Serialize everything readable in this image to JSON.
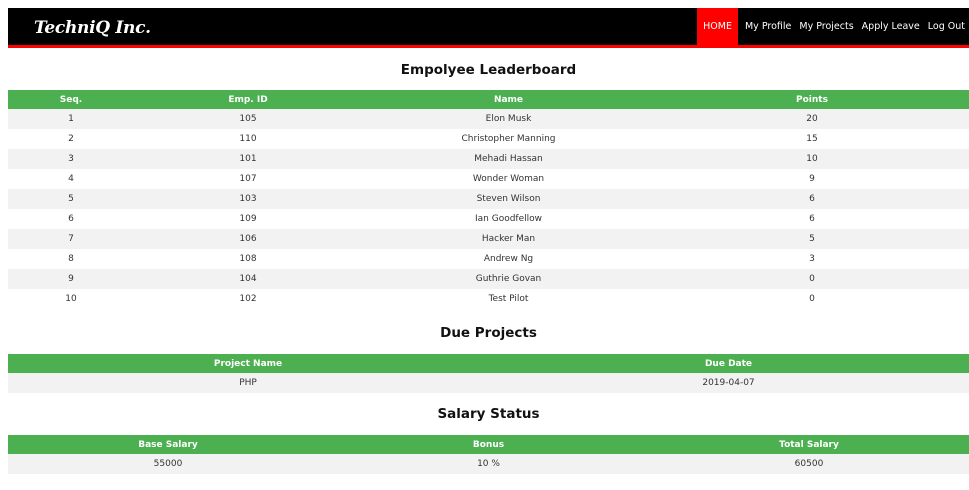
{
  "brand": "TechniQ Inc.",
  "nav": [
    {
      "label": "HOME",
      "active": true
    },
    {
      "label": "My Profile",
      "active": false
    },
    {
      "label": "My Projects",
      "active": false
    },
    {
      "label": "Apply Leave",
      "active": false
    },
    {
      "label": "Log Out",
      "active": false
    }
  ],
  "leaderboard": {
    "title": "Empolyee Leaderboard",
    "columns": [
      "Seq.",
      "Emp. ID",
      "Name",
      "Points"
    ],
    "rows": [
      [
        "1",
        "105",
        "Elon Musk",
        "20"
      ],
      [
        "2",
        "110",
        "Christopher Manning",
        "15"
      ],
      [
        "3",
        "101",
        "Mehadi Hassan",
        "10"
      ],
      [
        "4",
        "107",
        "Wonder Woman",
        "9"
      ],
      [
        "5",
        "103",
        "Steven Wilson",
        "6"
      ],
      [
        "6",
        "109",
        "Ian Goodfellow",
        "6"
      ],
      [
        "7",
        "106",
        "Hacker Man",
        "5"
      ],
      [
        "8",
        "108",
        "Andrew Ng",
        "3"
      ],
      [
        "9",
        "104",
        "Guthrie Govan",
        "0"
      ],
      [
        "10",
        "102",
        "Test Pilot",
        "0"
      ]
    ]
  },
  "projects": {
    "title": "Due Projects",
    "columns": [
      "Project Name",
      "Due Date"
    ],
    "rows": [
      [
        "PHP",
        "2019-04-07"
      ]
    ]
  },
  "salary": {
    "title": "Salary Status",
    "columns": [
      "Base Salary",
      "Bonus",
      "Total Salary"
    ],
    "rows": [
      [
        "55000",
        "10 %",
        "60500"
      ]
    ]
  },
  "colors": {
    "header_green": "#4caf50",
    "nav_active": "#ff0000",
    "nav_bg": "#000000"
  }
}
